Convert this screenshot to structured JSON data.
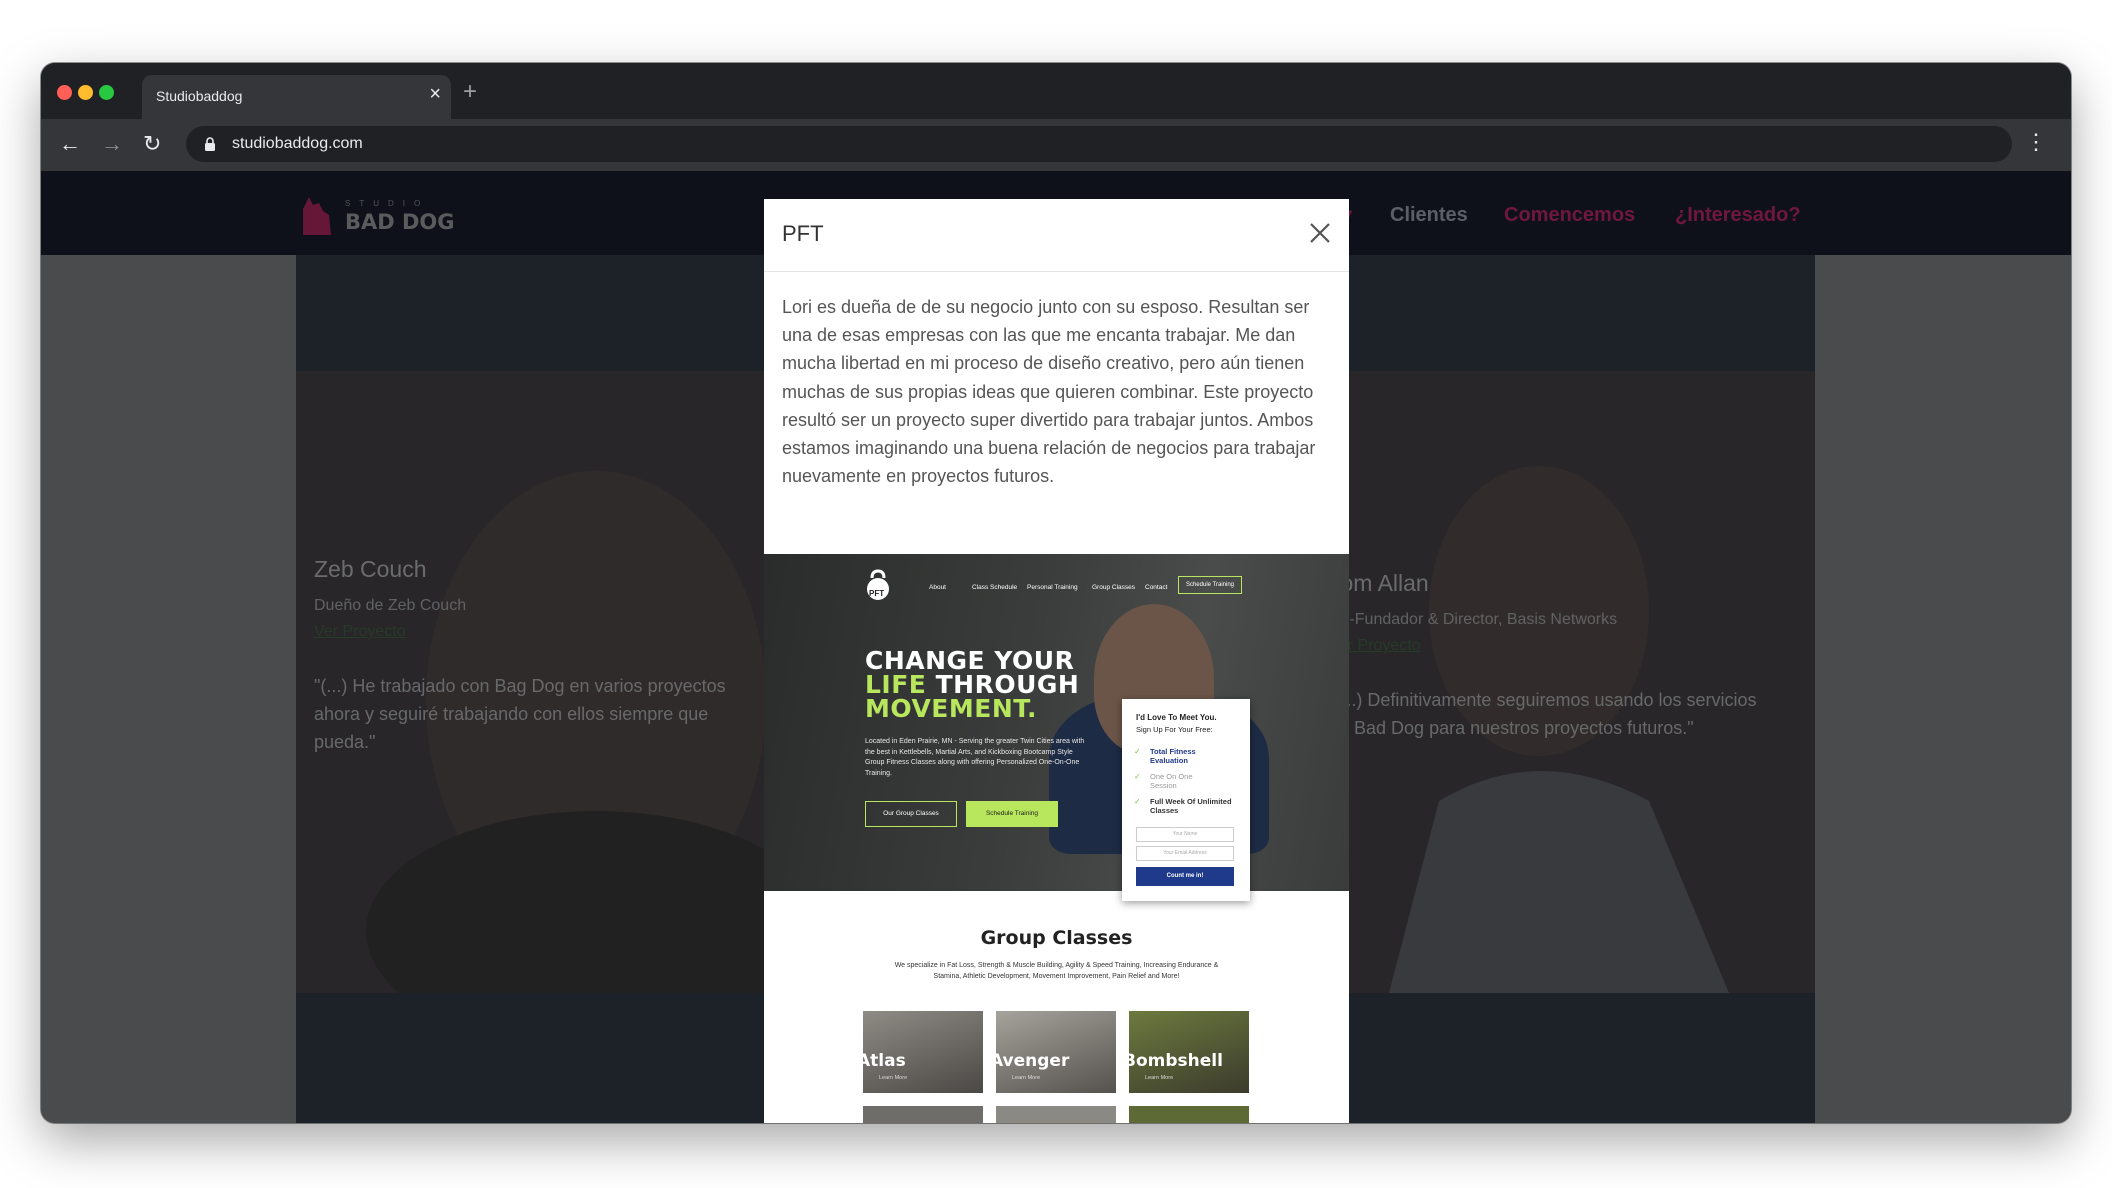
{
  "browser": {
    "tab_title": "Studiobaddog",
    "tab_close": "×",
    "new_tab": "+",
    "url": "studiobaddog.com",
    "back": "←",
    "forward": "→",
    "reload": "↻",
    "menu": "⋮"
  },
  "site": {
    "logo_text": "STUDIO BAD DOG",
    "nav": {
      "clientes": "Clientes",
      "comencemos": "Comencemos",
      "interesado": "¿Interesado?"
    },
    "cards": [
      {
        "name": "Zeb Couch",
        "role": "Dueño de Zeb Couch",
        "link": "Ver Proyecto",
        "quote": "\"(...) He trabajado con Bag Dog en varios proyectos ahora y seguiré trabajando con ellos siempre que pueda.\""
      },
      {
        "name": "Tom Allan",
        "role": "Co-Fundador & Director, Basis Networks",
        "link": "Ver Proyecto",
        "quote": "\"(...) Definitivamente seguiremos usando los servicios de Bad Dog para nuestros proyectos futuros.\""
      }
    ]
  },
  "modal": {
    "title": "PFT",
    "body": "Lori es dueña de de su negocio junto con su esposo. Resultan ser una de esas empresas con las que me encanta trabajar. Me dan mucha libertad en mi proceso de diseño creativo, pero aún tienen muchas de sus propias ideas que quieren combinar. Este proyecto resultó ser un proyecto super divertido para trabajar juntos. Ambos estamos imaginando una buena relación de negocios para trabajar nuevamente en proyectos futuros.",
    "screenshot": {
      "logo": "PFT",
      "nav": [
        "About",
        "Class Schedule",
        "Personal Training",
        "Group Classes",
        "Contact"
      ],
      "nav_button": "Schedule Training",
      "headline": [
        "CHANGE YOUR",
        "LIFE THROUGH",
        "MOVEMENT."
      ],
      "headline_lime_word": "LIFE",
      "hero_text": "Located in Eden Prairie, MN - Serving the greater Twin Cities area with the best in Kettlebells, Martial Arts, and Kickboxing Bootcamp Style Group Fitness Classes along with offering Personalized One-On-One Training.",
      "cta_primary": "Our Group Classes",
      "cta_secondary": "Schedule Training",
      "form_title": "I'd Love To Meet You.",
      "form_subtitle": "Sign Up For Your Free:",
      "form_items": [
        "Total Fitness Evaluation",
        "One On One Session",
        "Full Week Of Unlimited Classes"
      ],
      "form_name_placeholder": "Your Name",
      "form_email_placeholder": "Your Email Address",
      "form_button": "Count me in!",
      "section_title": "Group Classes",
      "section_text": "We specialize in Fat Loss, Strength & Muscle Building, Agility & Speed Training, Increasing Endurance & Stamina, Athletic Development, Movement Improvement, Pain Relief and More!",
      "classes": [
        {
          "name": "Atlas",
          "more": "Learn More"
        },
        {
          "name": "Avenger",
          "more": "Learn More"
        },
        {
          "name": "Bombshell",
          "more": "Learn More"
        }
      ]
    }
  },
  "colors": {
    "accent_pink": "#c2185b",
    "nav_gray": "#9aa0aa",
    "lime": "#b8e65c",
    "navy": "#1f3a8a"
  }
}
